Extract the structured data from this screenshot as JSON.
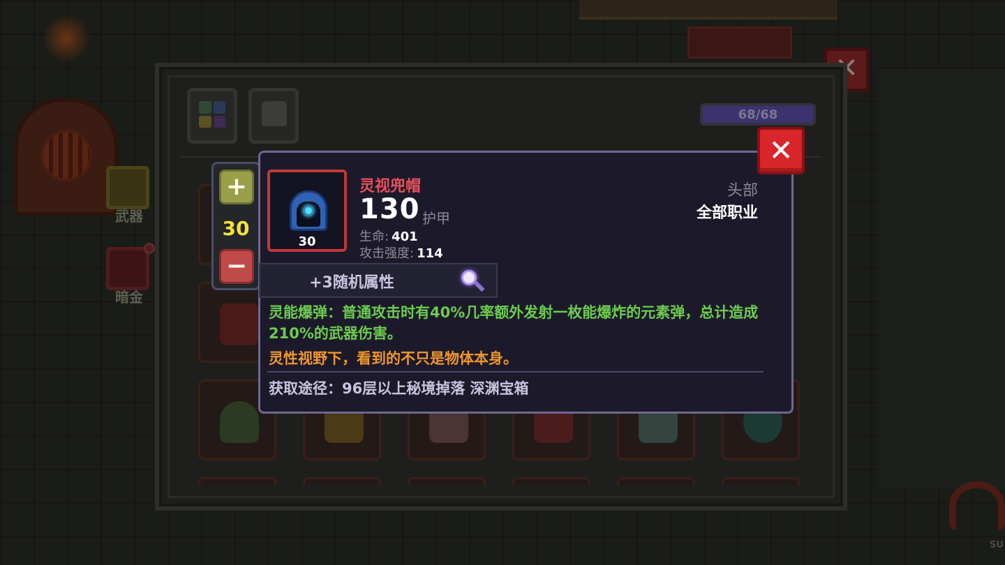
{
  "side_tabs": [
    {
      "label": "武器"
    },
    {
      "label": "暗金"
    }
  ],
  "mana": {
    "text": "68/68",
    "fraction": 1.0
  },
  "stepper": {
    "plus": "+",
    "minus": "−",
    "value": "30"
  },
  "item": {
    "name": "灵视兜帽",
    "level": "30",
    "armor_value": "130",
    "armor_label": "护甲",
    "stats": [
      {
        "label": "生命:",
        "value": "401"
      },
      {
        "label": "攻击强度:",
        "value": "114"
      }
    ],
    "slot": "头部",
    "class": "全部职业",
    "random_attributes": "+3随机属性",
    "effect_text": "灵能爆弹：普通攻击时有40%几率额外发射一枚能爆炸的元素弹，总计造成210%的武器伤害。",
    "flavor_text": "灵性视野下，看到的不只是物体本身。",
    "source": "获取途径：96层以上秘境掉落 深渊宝箱"
  },
  "close_glyph": "✕",
  "bg_logo": "SU",
  "colors": {
    "rarity_red": "#e8505a",
    "effect_green": "#6ccc4e",
    "flavor_orange": "#f0962c",
    "stepper_value_yellow": "#f4e23a",
    "close_red": "#d8262a"
  },
  "icons": [
    "plus-icon",
    "minus-icon",
    "magnifier-icon",
    "close-icon",
    "hood-icon"
  ]
}
